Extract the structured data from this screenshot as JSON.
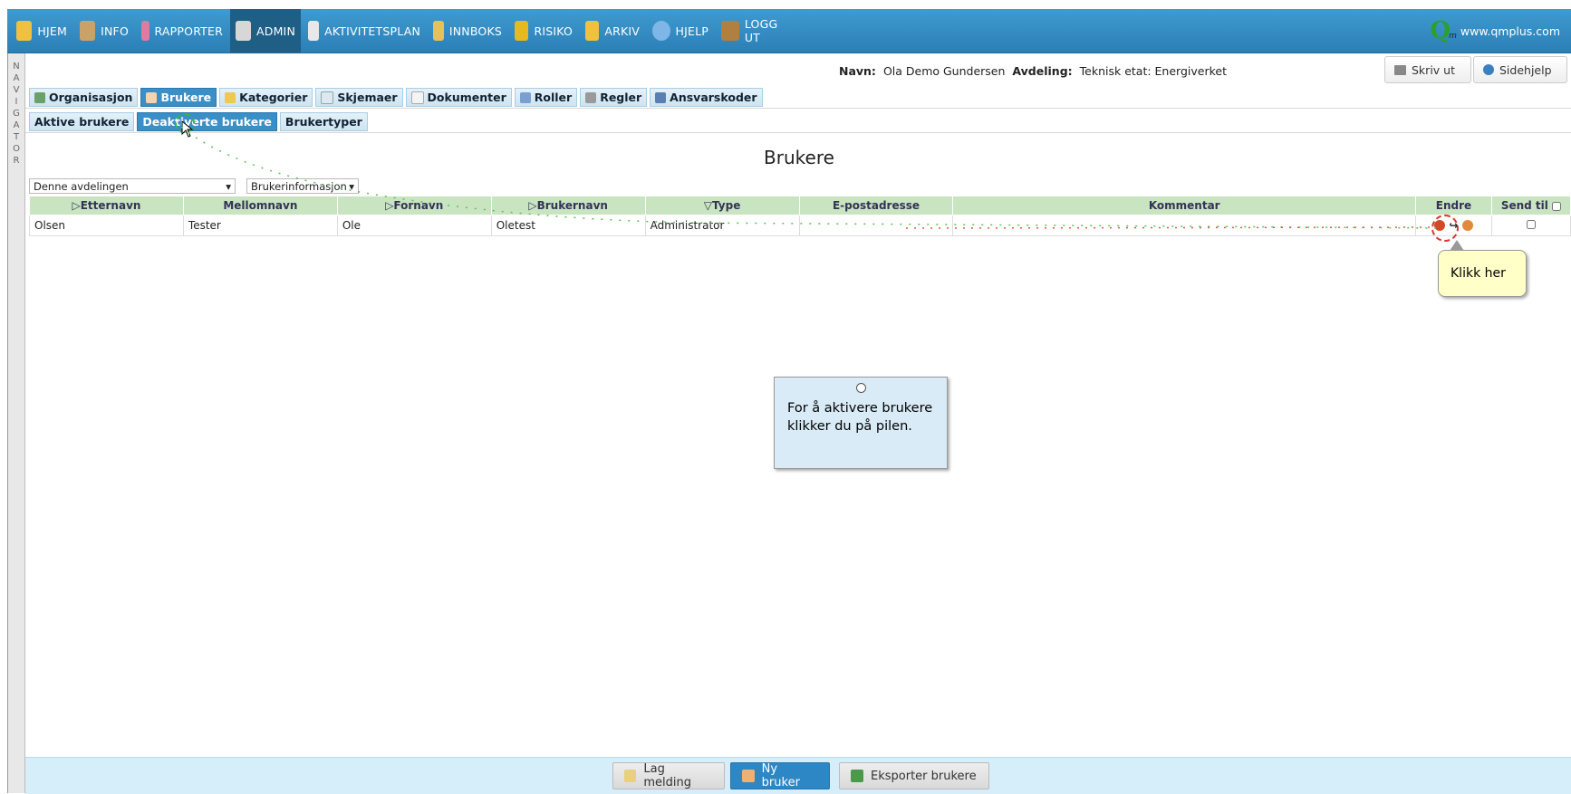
{
  "topnav": {
    "items": [
      {
        "label": "HJEM",
        "icon": "home-icon",
        "color": "#f0c040"
      },
      {
        "label": "INFO",
        "icon": "info-binders-icon",
        "color": "#c9a26a"
      },
      {
        "label": "RAPPORTER",
        "icon": "reports-icon",
        "color": "#e07aa0"
      },
      {
        "label": "ADMIN",
        "icon": "gears-icon",
        "color": "#d7d7d7"
      },
      {
        "label": "AKTIVITETSPLAN",
        "icon": "calendar-icon",
        "color": "#e8e8e8"
      },
      {
        "label": "INNBOKS",
        "icon": "inbox-icon",
        "color": "#e8c05a"
      },
      {
        "label": "RISIKO",
        "icon": "warning-icon",
        "color": "#e8b820"
      },
      {
        "label": "ARKIV",
        "icon": "folder-icon",
        "color": "#f0c040"
      },
      {
        "label": "HJELP",
        "icon": "help-icon",
        "color": "#7fb6e8"
      },
      {
        "label": "LOGG UT",
        "icon": "logout-door-icon",
        "color": "#b08040"
      }
    ],
    "active_index": 3,
    "logo_letter": "Q",
    "logo_sub": "m",
    "site": "www.qmplus.com"
  },
  "navigator": {
    "letters": [
      "N",
      "A",
      "V",
      "I",
      "G",
      "A",
      "T",
      "O",
      "R"
    ]
  },
  "header": {
    "name_label": "Navn:",
    "name_value": "Ola Demo Gundersen",
    "dept_label": "Avdeling:",
    "dept_value": "Teknisk etat: Energiverket",
    "print_button": "Skriv ut",
    "help_button": "Sidehjelp"
  },
  "tabs": [
    {
      "label": "Organisasjon",
      "icon": "org-chart-icon"
    },
    {
      "label": "Brukere",
      "icon": "user-icon"
    },
    {
      "label": "Kategorier",
      "icon": "category-folder-icon"
    },
    {
      "label": "Skjemaer",
      "icon": "form-icon"
    },
    {
      "label": "Dokumenter",
      "icon": "document-icon"
    },
    {
      "label": "Roller",
      "icon": "roles-icon"
    },
    {
      "label": "Regler",
      "icon": "rules-wrench-icon"
    },
    {
      "label": "Ansvarskoder",
      "icon": "responsibility-icon"
    }
  ],
  "subtabs": [
    {
      "label": "Aktive brukere"
    },
    {
      "label": "Deaktiverte brukere"
    },
    {
      "label": "Brukertyper"
    }
  ],
  "page_title": "Brukere",
  "filters": {
    "department": "Denne avdelingen",
    "info": "Brukerinformasjon"
  },
  "table": {
    "headers": [
      "Etternavn",
      "Mellomnavn",
      "Fornavn",
      "Brukernavn",
      "Type",
      "E-postadresse",
      "Kommentar",
      "Endre",
      "Send til"
    ],
    "rows": [
      [
        "Olsen",
        "Tester",
        "Ole",
        "Oletest",
        "Administrator",
        "",
        "",
        "",
        ""
      ]
    ]
  },
  "callouts": {
    "click_here": "Klikk her",
    "info": "For å aktivere brukere klikker du på pilen."
  },
  "bottom": {
    "message_button": "Lag melding",
    "new_user_button": "Ny bruker",
    "export_button": "Eksporter brukere"
  }
}
